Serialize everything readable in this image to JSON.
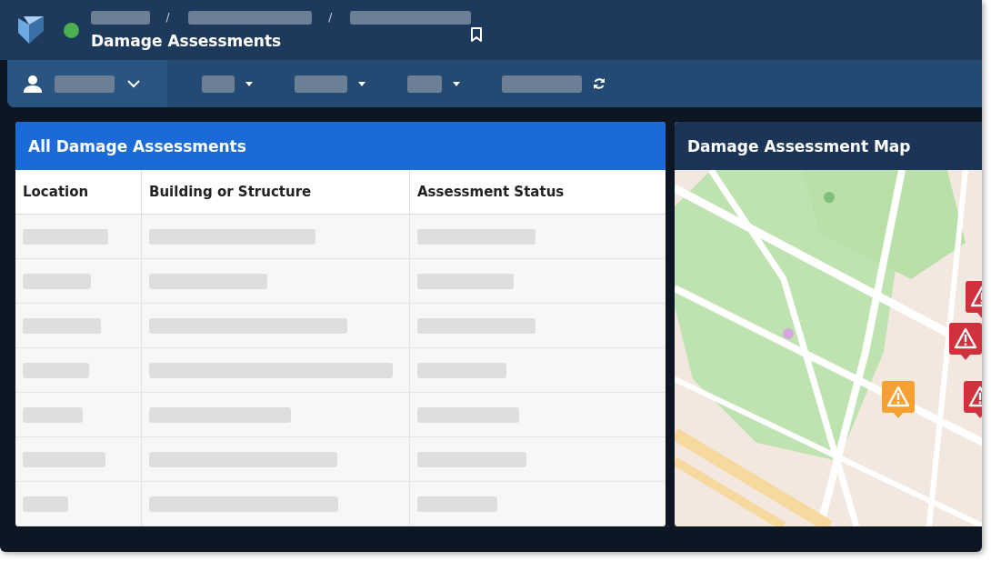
{
  "header": {
    "status": {
      "color": "#4caf50"
    },
    "breadcrumbs": [
      {
        "kind": "loading"
      },
      {
        "kind": "loading",
        "separator": "/"
      },
      {
        "kind": "loading",
        "separator": "/"
      }
    ],
    "title": "Damage Assessments"
  },
  "toolbar": {
    "user": {
      "kind": "loading"
    },
    "items": [
      {
        "kind": "dropdown"
      },
      {
        "kind": "dropdown"
      },
      {
        "kind": "dropdown"
      },
      {
        "kind": "refresh"
      }
    ]
  },
  "table": {
    "title": "All Damage Assessments",
    "columns": [
      "Location",
      "Building or Structure",
      "Assessment Status"
    ],
    "rows": [
      {
        "kind": "loading"
      },
      {
        "kind": "loading"
      },
      {
        "kind": "loading"
      },
      {
        "kind": "loading"
      },
      {
        "kind": "loading"
      },
      {
        "kind": "loading"
      },
      {
        "kind": "loading"
      }
    ]
  },
  "map": {
    "title": "Damage Assessment Map",
    "kind": "picture",
    "markers": [
      {
        "kind": "warning",
        "color": "#d0313d"
      },
      {
        "kind": "warning",
        "color": "#d0313d"
      },
      {
        "kind": "warning",
        "color": "#f5a030"
      },
      {
        "kind": "warning",
        "color": "#d0313d"
      }
    ]
  }
}
